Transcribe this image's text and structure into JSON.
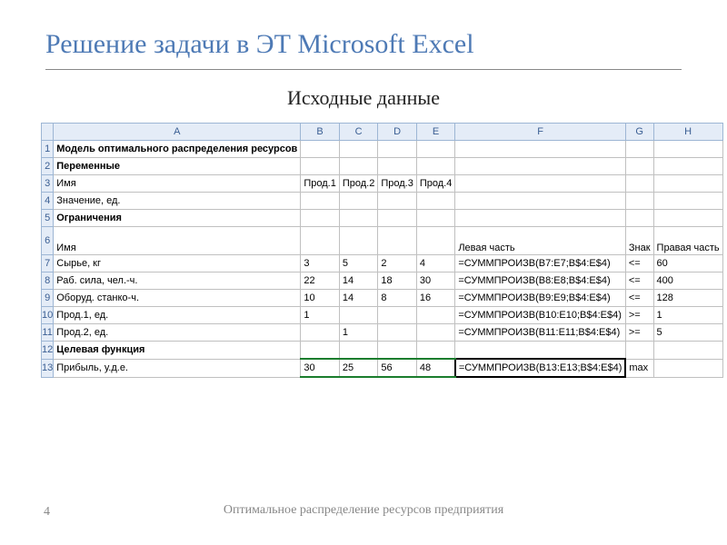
{
  "slide": {
    "title": "Решение задачи в ЭТ Microsoft Excel",
    "subtitle": "Исходные данные",
    "footer": "Оптимальное распределение ресурсов  предприятия",
    "page_number": "4"
  },
  "spreadsheet": {
    "columns": [
      "A",
      "B",
      "C",
      "D",
      "E",
      "F",
      "G",
      "H"
    ],
    "rows": [
      {
        "n": "1",
        "cells": {
          "A": "Модель оптимального распределения ресурсов"
        }
      },
      {
        "n": "2",
        "cells": {
          "A": "Переменные"
        }
      },
      {
        "n": "3",
        "cells": {
          "A": "Имя",
          "B": "Прод.1",
          "C": "Прод.2",
          "D": "Прод.3",
          "E": "Прод.4"
        }
      },
      {
        "n": "4",
        "cells": {
          "A": "Значение, ед."
        }
      },
      {
        "n": "5",
        "cells": {
          "A": "Ограничения"
        }
      },
      {
        "n": "6",
        "cells": {
          "A": "Имя",
          "F": "Левая часть",
          "G": "Знак",
          "H": "Правая часть"
        }
      },
      {
        "n": "7",
        "cells": {
          "A": "Сырье, кг",
          "B": "3",
          "C": "5",
          "D": "2",
          "E": "4",
          "F": "=СУММПРОИЗВ(B7:E7;B$4:E$4)",
          "G": "<=",
          "H": "60"
        }
      },
      {
        "n": "8",
        "cells": {
          "A": "Раб. сила, чел.-ч.",
          "B": "22",
          "C": "14",
          "D": "18",
          "E": "30",
          "F": "=СУММПРОИЗВ(B8:E8;B$4:E$4)",
          "G": "<=",
          "H": "400"
        }
      },
      {
        "n": "9",
        "cells": {
          "A": "Оборуд. станко-ч.",
          "B": "10",
          "C": "14",
          "D": "8",
          "E": "16",
          "F": "=СУММПРОИЗВ(B9:E9;B$4:E$4)",
          "G": "<=",
          "H": "128"
        }
      },
      {
        "n": "10",
        "cells": {
          "A": "Прод.1, ед.",
          "B": "1",
          "F": "=СУММПРОИЗВ(B10:E10;B$4:E$4)",
          "G": ">=",
          "H": "1"
        }
      },
      {
        "n": "11",
        "cells": {
          "A": "Прод.2, ед.",
          "C": "1",
          "F": "=СУММПРОИЗВ(B11:E11;B$4:E$4)",
          "G": ">=",
          "H": "5"
        }
      },
      {
        "n": "12",
        "cells": {
          "A": "Целевая функция"
        }
      },
      {
        "n": "13",
        "cells": {
          "A": "Прибыль, у.д.е.",
          "B": "30",
          "C": "25",
          "D": "56",
          "E": "48",
          "F": "=СУММПРОИЗВ(B13:E13;B$4:E$4)",
          "G": "max"
        }
      }
    ],
    "bold_cells": [
      "1A",
      "2A",
      "5A",
      "12A"
    ],
    "tall_rows": [
      "6"
    ],
    "active_cell": "F13",
    "green_range": "B13:E13",
    "selected_row_header": "13",
    "selected_col_header": "F"
  }
}
